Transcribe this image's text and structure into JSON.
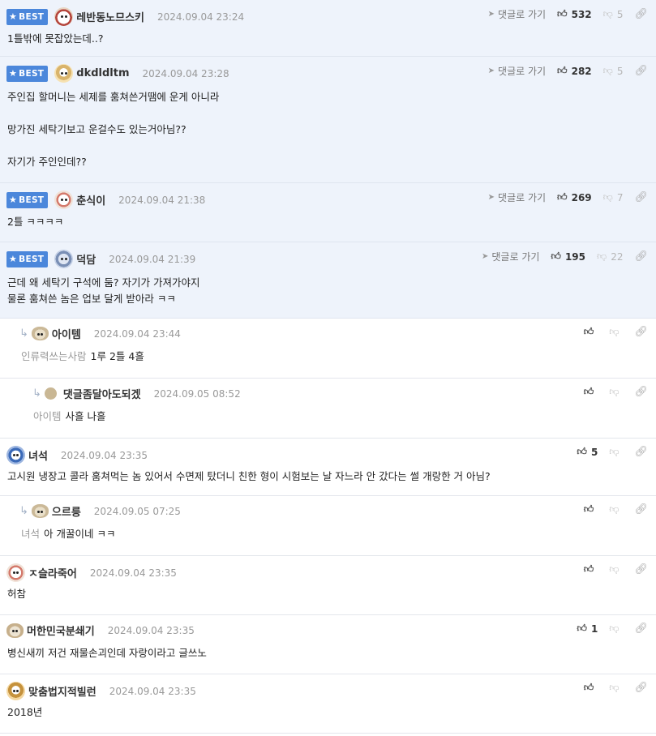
{
  "labels": {
    "best": "BEST",
    "goto": "댓글로 가기"
  },
  "comments": [
    {
      "best": true,
      "avatar": "panda",
      "nick": "레반동노므스키",
      "date": "2024.09.04 23:24",
      "likes": "532",
      "dislikes": "5",
      "body": "1틀밖에 못잡았는데..?"
    },
    {
      "best": true,
      "avatar": "dog",
      "nick": "dkdldltm",
      "date": "2024.09.04 23:28",
      "likes": "282",
      "dislikes": "5",
      "body": "주인집 할머니는 세제를 훔쳐쓴거땜에 운게 아니라\n\n망가진 세탁기보고 운걸수도 있는거아님??\n\n자기가 주인인데??"
    },
    {
      "best": true,
      "avatar": "puppy",
      "nick": "춘식이",
      "date": "2024.09.04 21:38",
      "likes": "269",
      "dislikes": "7",
      "body": "2틀 ㅋㅋㅋㅋ"
    },
    {
      "best": true,
      "avatar": "koala",
      "nick": "덕담",
      "date": "2024.09.04 21:39",
      "likes": "195",
      "dislikes": "22",
      "body": "근데 왜 세탁기 구석에 둠? 자기가 가져가야지\n물론 훔쳐쓴 놈은 업보 달게 받아라 ㅋㅋ"
    },
    {
      "depth": 1,
      "avatar": "small",
      "nick": "아이템",
      "date": "2024.09.04 23:44",
      "mention": "인류력쓰는사람",
      "body": "1루 2틀 4흘"
    },
    {
      "depth": 2,
      "avatar": "circle",
      "nick": "댓글좀달아도되겠",
      "date": "2024.09.05 08:52",
      "mention": "아이템",
      "body": "사흘 나흘"
    },
    {
      "avatar": "blue",
      "nick": "녀석",
      "date": "2024.09.04 23:35",
      "likes": "5",
      "body": "고시원 냉장고 콜라 훔쳐먹는 놈 있어서 수면제 탔더니 친한 형이 시험보는 날 자느라 안 갔다는 썰 개랑한 거 아님?"
    },
    {
      "depth": 1,
      "avatar": "small",
      "nick": "으르릉",
      "date": "2024.09.05 07:25",
      "mention": "녀석",
      "body": "아 개꿀이네 ㅋㅋ"
    },
    {
      "avatar": "puppy",
      "nick": "ㅈ슬라죽어",
      "date": "2024.09.04 23:35",
      "body": "허참"
    },
    {
      "avatar": "sheep",
      "nick": "머한민국분쇄기",
      "date": "2024.09.04 23:35",
      "likes": "1",
      "body": "병신새끼 저건 재물손괴인데 자랑이라고 글쓰노"
    },
    {
      "avatar": "shiba",
      "nick": "맞춤법지적빌런",
      "date": "2024.09.04 23:35",
      "body": "2018년"
    }
  ]
}
